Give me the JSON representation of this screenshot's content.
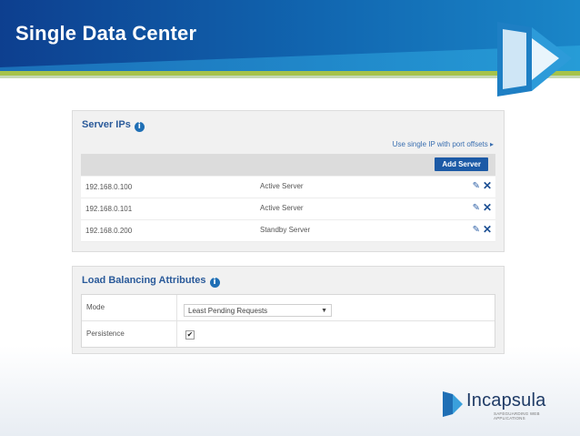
{
  "slide": {
    "title": "Single Data Center"
  },
  "server_ips": {
    "title": "Server IPs",
    "info_icon": "info-icon",
    "port_offsets_link": "Use single IP with port offsets ▸",
    "add_server_label": "Add Server",
    "rows": [
      {
        "ip": "192.168.0.100",
        "role": "Active Server"
      },
      {
        "ip": "192.168.0.101",
        "role": "Active Server"
      },
      {
        "ip": "192.168.0.200",
        "role": "Standby Server"
      }
    ],
    "edit_icon": "pencil-icon",
    "delete_icon": "close-icon"
  },
  "load_balancing": {
    "title": "Load Balancing Attributes",
    "mode_label": "Mode",
    "mode_value": "Least Pending Requests",
    "persistence_label": "Persistence",
    "persistence_checked": true
  },
  "brand": {
    "name": "Incapsula",
    "tagline": "SAFEGUARDING WEB APPLICATIONS",
    "colors": {
      "banner": "#1166b0",
      "accent_green": "#a6c34a",
      "button": "#1c5aa6"
    }
  }
}
